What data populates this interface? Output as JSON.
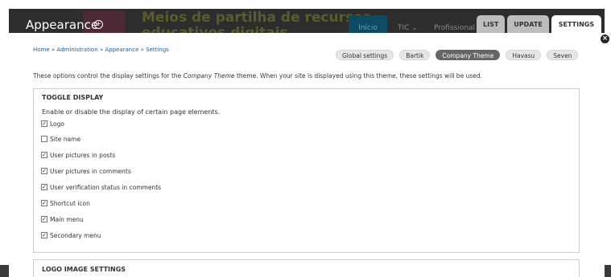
{
  "background_site": {
    "title_line1": "Meios de partilha de recursos",
    "title_line2": "educativos digitais",
    "nav": [
      "Início",
      "TIC ⌄",
      "Profissional d"
    ]
  },
  "overlay": {
    "title": "Appearance",
    "title_icon": "shortcut-add-icon",
    "tabs": [
      {
        "label": "List",
        "active": false
      },
      {
        "label": "Update",
        "active": false
      },
      {
        "label": "Settings",
        "active": true
      }
    ],
    "close_icon": "close-icon"
  },
  "breadcrumb": "Home » Administration » Appearance » Settings",
  "theme_buttons": [
    {
      "label": "Global settings",
      "active": false
    },
    {
      "label": "Bartik",
      "active": false
    },
    {
      "label": "Company Theme",
      "active": true
    },
    {
      "label": "Havasu",
      "active": false
    },
    {
      "label": "Seven",
      "active": false
    }
  ],
  "description": {
    "before": "These options control the display settings for the ",
    "theme": "Company Theme",
    "after": " theme. When your site is displayed using this theme, these settings will be used."
  },
  "toggle_display": {
    "legend": "TOGGLE DISPLAY",
    "description": "Enable or disable the display of certain page elements.",
    "options": [
      {
        "label": "Logo",
        "checked": true
      },
      {
        "label": "Site name",
        "checked": false
      },
      {
        "label": "User pictures in posts",
        "checked": true
      },
      {
        "label": "User pictures in comments",
        "checked": true
      },
      {
        "label": "User verification status in comments",
        "checked": true
      },
      {
        "label": "Shortcut icon",
        "checked": true
      },
      {
        "label": "Main menu",
        "checked": true
      },
      {
        "label": "Secondary menu",
        "checked": true
      }
    ]
  },
  "logo_settings": {
    "legend": "LOGO IMAGE SETTINGS"
  },
  "colors": {
    "overlay_bg": "#2d2d2d",
    "link": "#1a5e9a",
    "active_button": "#666666"
  }
}
